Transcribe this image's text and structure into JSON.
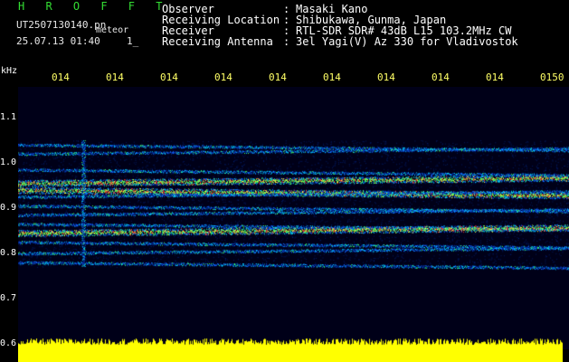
{
  "header": {
    "brand": "H R O F F T",
    "filename": "UT2507130140.pn",
    "filetype": "meteor",
    "datetime": "25.07.13 01:40",
    "counter": "1_"
  },
  "info": [
    {
      "label": "Observer",
      "value": "Masaki Kano"
    },
    {
      "label": "Receiving Location",
      "value": "Shibukawa, Gunma, Japan"
    },
    {
      "label": "Receiver",
      "value": "RTL-SDR SDR# 43dB L15 103.2MHz CW"
    },
    {
      "label": "Receiving Antenna",
      "value": "3el Yagi(V) Az 330 for Vladivostok"
    }
  ],
  "axis": {
    "unit": "kHz",
    "y_ticks": [
      {
        "label": "1.1",
        "value": 1.1
      },
      {
        "label": "1.0",
        "value": 1.0
      },
      {
        "label": "0.9",
        "value": 0.9
      },
      {
        "label": "0.8",
        "value": 0.8
      },
      {
        "label": "0.7",
        "value": 0.7
      },
      {
        "label": "0.6",
        "value": 0.6
      }
    ],
    "x_ticks": [
      "014",
      "014",
      "014",
      "014",
      "014",
      "014",
      "014",
      "014",
      "014",
      "0150"
    ]
  },
  "spectrum": {
    "bands_khz": [
      1.04,
      1.02,
      0.985,
      0.955,
      0.94,
      0.925,
      0.905,
      0.885,
      0.865,
      0.845,
      0.825,
      0.8,
      0.78
    ]
  },
  "colors": {
    "background": "#000000",
    "brand": "#33dd33",
    "tick_time": "#ffff66",
    "text": "#ffffff",
    "plot_bg": "#000018",
    "power_bar": "#ffff00"
  }
}
